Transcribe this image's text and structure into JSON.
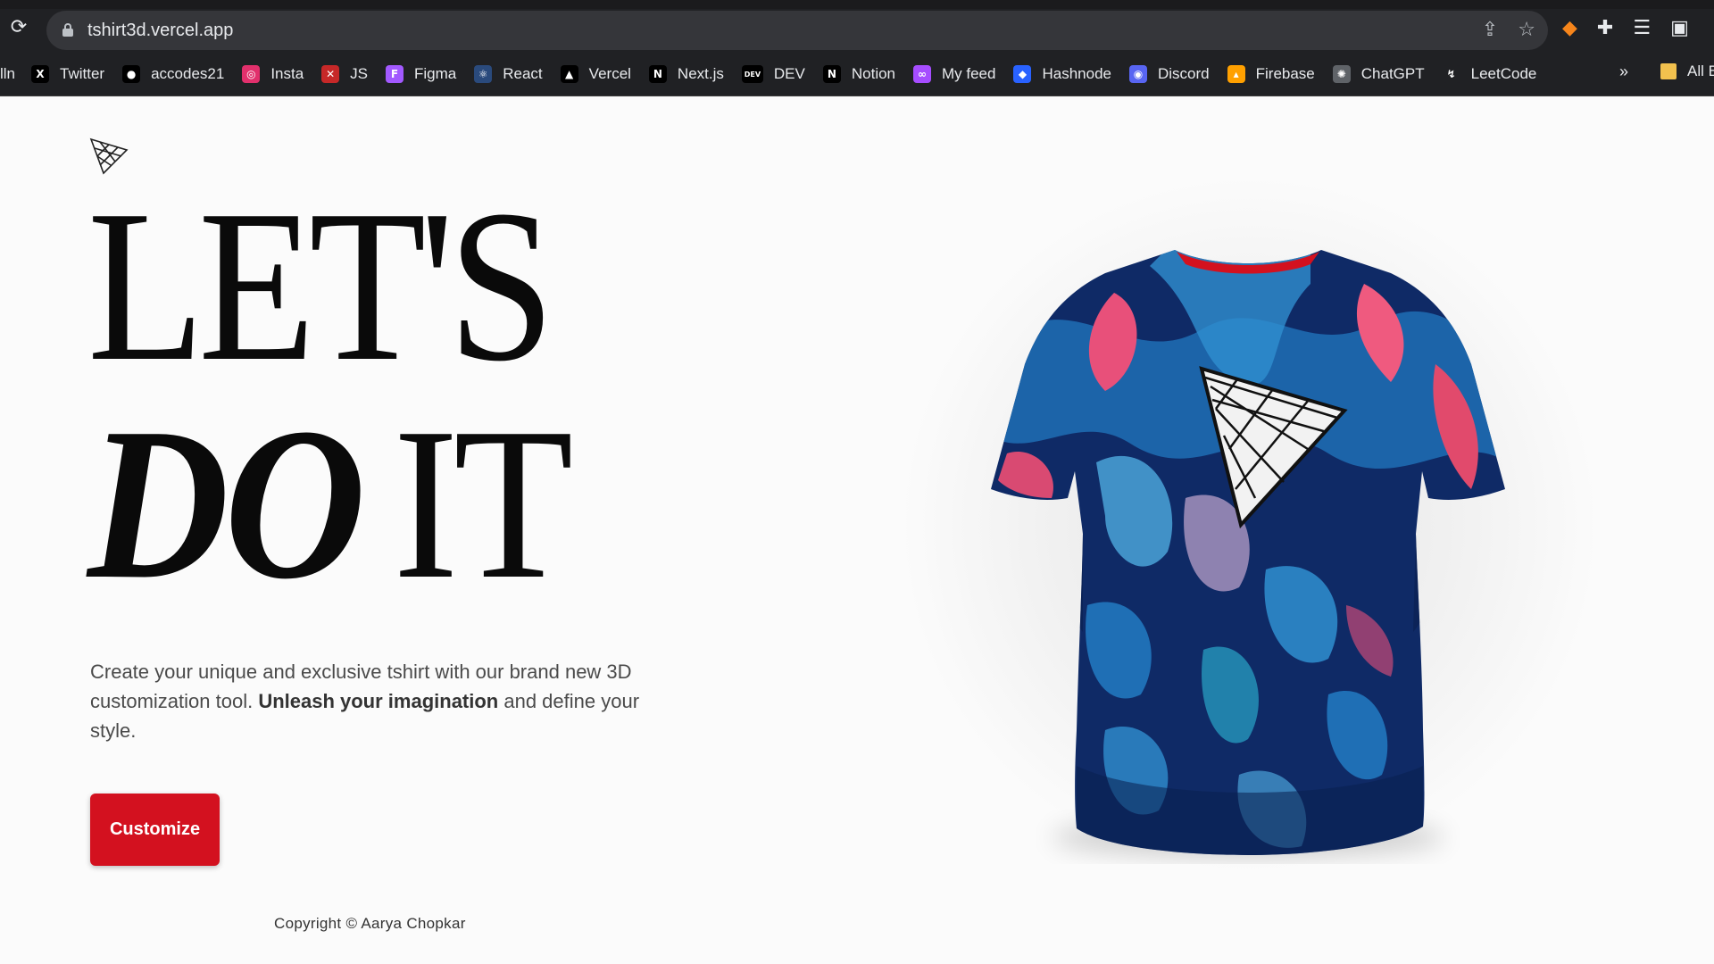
{
  "browser": {
    "url": "tshirt3d.vercel.app",
    "bookmarks": [
      {
        "label": "lln",
        "icon": "none",
        "color": "#202124"
      },
      {
        "label": "Twitter",
        "icon": "x-icon",
        "color": "#000000"
      },
      {
        "label": "accodes21",
        "icon": "github-icon",
        "color": "#000000"
      },
      {
        "label": "Insta",
        "icon": "instagram-icon",
        "color": "#e1306c"
      },
      {
        "label": "JS",
        "icon": "js-icon",
        "color": "#c62828"
      },
      {
        "label": "Figma",
        "icon": "figma-icon",
        "color": "#a259ff"
      },
      {
        "label": "React",
        "icon": "react-icon",
        "color": "#2a4a7c"
      },
      {
        "label": "Vercel",
        "icon": "vercel-icon",
        "color": "#000000"
      },
      {
        "label": "Next.js",
        "icon": "nextjs-icon",
        "color": "#000000"
      },
      {
        "label": "DEV",
        "icon": "dev-icon",
        "color": "#000000"
      },
      {
        "label": "Notion",
        "icon": "notion-icon",
        "color": "#000000"
      },
      {
        "label": "My feed",
        "icon": "dailydev-icon",
        "color": "#a64dff"
      },
      {
        "label": "Hashnode",
        "icon": "hashnode-icon",
        "color": "#2962ff"
      },
      {
        "label": "Discord",
        "icon": "discord-icon",
        "color": "#5865f2"
      },
      {
        "label": "Firebase",
        "icon": "firebase-icon",
        "color": "#ffa000"
      },
      {
        "label": "ChatGPT",
        "icon": "chatgpt-icon",
        "color": "#5f6368"
      },
      {
        "label": "LeetCode",
        "icon": "leetcode-icon",
        "color": "#202124"
      }
    ],
    "more": "»",
    "all_bookmarks": "All B"
  },
  "hero": {
    "line1": "LET'S",
    "line2_italic": "DO",
    "line2_rest": "IT",
    "desc_part1": "Create your unique and exclusive tshirt with our brand new 3D customization tool. ",
    "desc_bold": "Unleash your imagination",
    "desc_part2": " and define your style.",
    "cta_label": "Customize",
    "accent_color": "#d3111f"
  },
  "footer": {
    "copyright": "Copyright © Aarya Chopkar"
  }
}
